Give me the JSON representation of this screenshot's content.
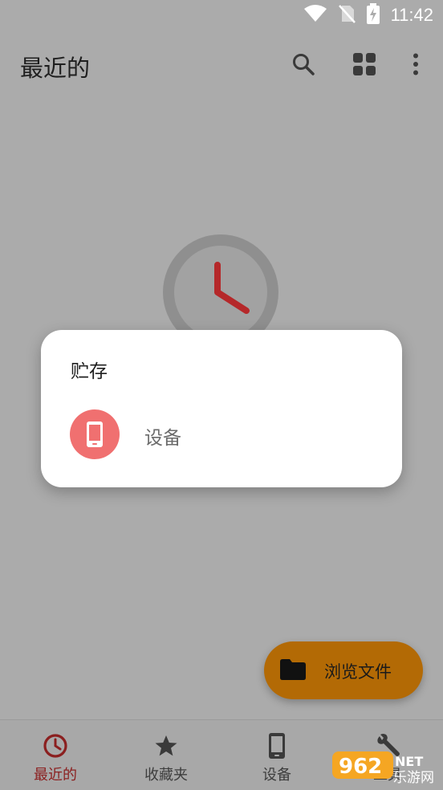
{
  "status_bar": {
    "time": "11:42"
  },
  "top_bar": {
    "title": "最近的"
  },
  "dialog": {
    "title": "贮存",
    "items": [
      {
        "label": "设备",
        "icon": "phone-icon"
      }
    ]
  },
  "fab": {
    "label": "浏览文件",
    "icon": "folder-icon"
  },
  "bottom_nav": {
    "items": [
      {
        "label": "最近的",
        "icon": "clock-icon",
        "active": true
      },
      {
        "label": "收藏夹",
        "icon": "star-icon",
        "active": false
      },
      {
        "label": "设备",
        "icon": "phone-icon",
        "active": false
      },
      {
        "label": "工具",
        "icon": "wrench-icon",
        "active": false
      }
    ]
  },
  "watermark": {
    "brand": "962",
    "suffix": "NET",
    "cn": "乐游网"
  },
  "colors": {
    "scrim_background": "#ababab",
    "accent_red": "#8b1f1f",
    "clock_hands": "#b5282a",
    "fab": "#b36a05",
    "storage_avatar": "#f07070"
  }
}
